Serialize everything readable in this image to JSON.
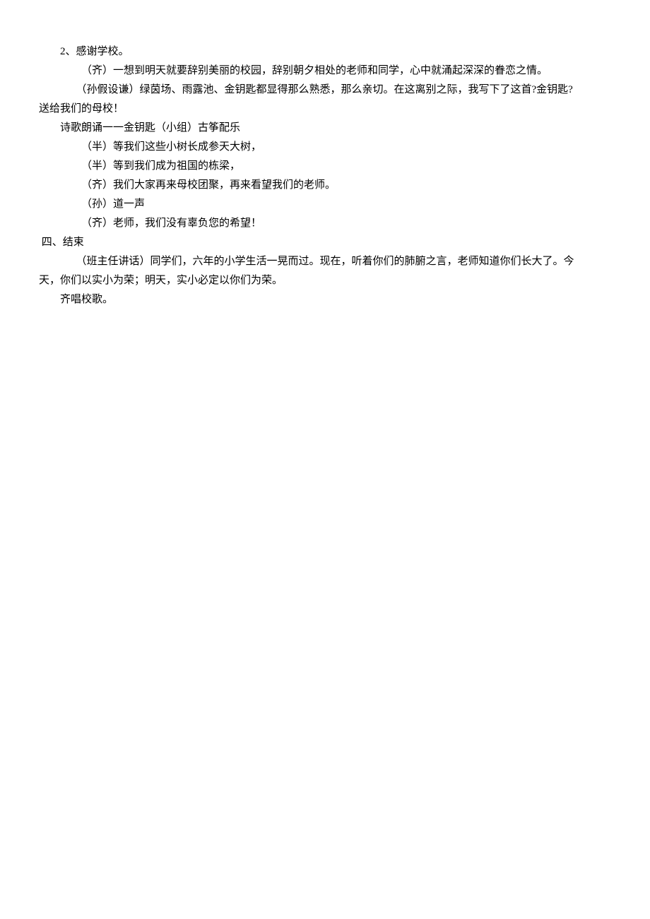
{
  "lines": [
    "2、感谢学校。",
    "（齐）一想到明天就要辞别美丽的校园，辞别朝夕相处的老师和同学，心中就涌起深深的眷恋之情。",
    "　　　　（孙假设谦）绿茵场、雨露池、金钥匙都显得那么熟悉，那么亲切。在这离别之际，我写下了这首?金钥匙?",
    "送给我们的母校！",
    "诗歌朗诵一一金钥匙（小组）古筝配乐",
    "（半）等我们这些小树长成参天大树，",
    "（半）等到我们成为祖国的栋梁，",
    "（齐）我们大家再来母校团聚，再来看望我们的老师。",
    "（孙）道一声",
    "（齐）老师，我们没有辜负您的希望！",
    " 四、结束",
    "　　　　（班主任讲话）同学们，六年的小学生活一晃而过。现在，听着你们的肺腑之言，老师知道你们长大了。今",
    "天，你们以实小为荣；明天，实小必定以你们为荣。",
    "齐唱校歌。"
  ]
}
